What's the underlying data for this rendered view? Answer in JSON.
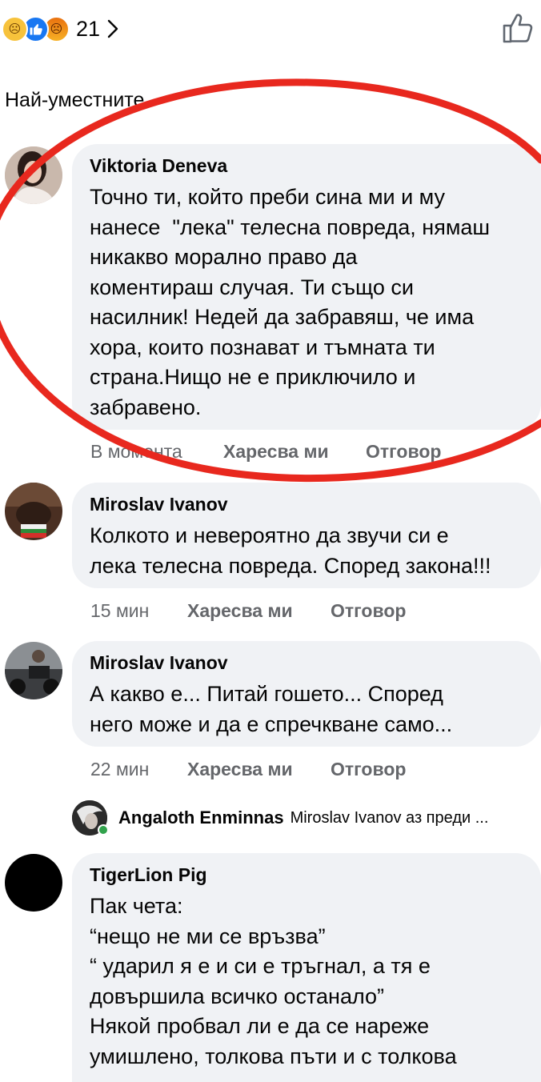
{
  "reactions": {
    "icons": [
      "sad-reaction-icon",
      "like-reaction-icon",
      "angry-reaction-icon"
    ],
    "count": "21"
  },
  "sort": {
    "label": "Най-уместните"
  },
  "comments": [
    {
      "author": "Viktoria Deneva",
      "lines": [
        "Точно ти, който преби сина ми и му",
        "нанесе  \"лека\" телесна повреда, нямаш",
        "никакво морално право да",
        "коментираш случая. Ти също си",
        "насилник! Недей да забравяш, че има",
        "хора, които познават и тъмната ти",
        "страна.Нищо не е приключило и",
        "забравено."
      ],
      "time": "В момента",
      "like": "Харесва ми",
      "reply": "Отговор"
    },
    {
      "author": "Miroslav Ivanov",
      "lines": [
        "Колкото и невероятно да звучи си е",
        "лека телесна повреда. Според закона!!!"
      ],
      "time": "15 мин",
      "like": "Харесва ми",
      "reply": "Отговор"
    },
    {
      "author": "Miroslav Ivanov",
      "lines": [
        "А какво е... Питай гошето... Според",
        "него може и да е спречкване само..."
      ],
      "time": "22 мин",
      "like": "Харесва ми",
      "reply": "Отговор"
    },
    {
      "author": "TigerLion Pig",
      "lines": [
        "Пак чета:",
        "“нещо не ми се връзва”",
        "“ ударил я е и си е тръгнал, а тя е",
        "довършила всичко останало”",
        "Някой пробвал ли е да се нареже",
        "умишлено, толкова пъти и с толкова"
      ]
    }
  ],
  "reply_preview": {
    "author": "Angaloth Enminnas",
    "text": "Miroslav Ivanov аз преди ..."
  },
  "colors": {
    "bubble": "#f0f2f5",
    "action_text": "#65676b",
    "like_blue": "#1877f2",
    "annotation_red": "#e8281e",
    "online_green": "#31a24c"
  }
}
